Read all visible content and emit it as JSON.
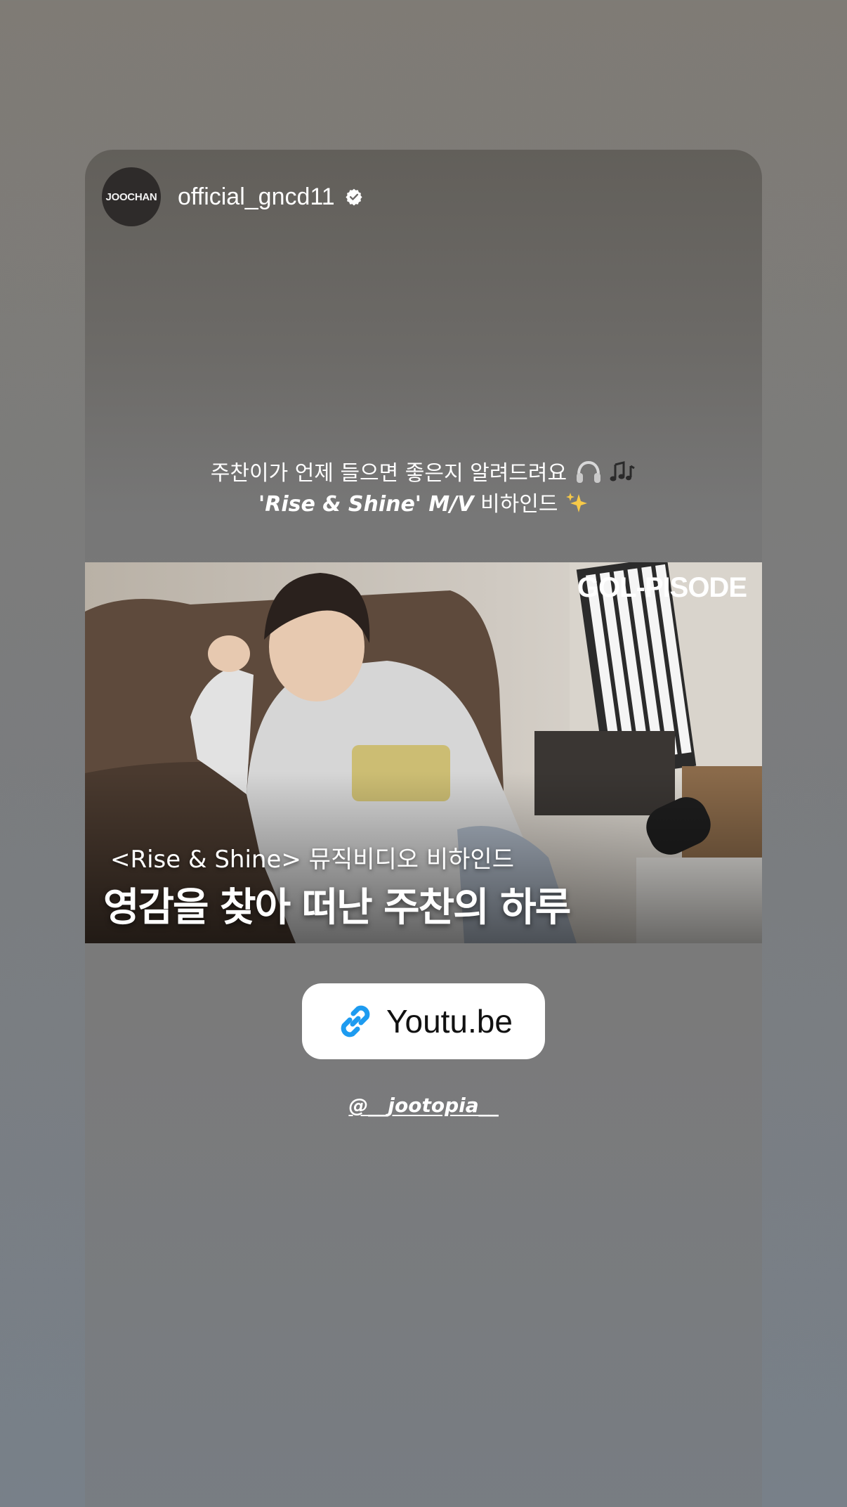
{
  "story": {
    "account": {
      "avatar_text": "JOOCHAN",
      "username": "official_gncd11",
      "verified_icon": "verified-badge-icon"
    },
    "caption": {
      "line1_text": "주찬이가 언제 들으면 좋은지 알려드려요",
      "line1_emojis": [
        "headphone-emoji",
        "music-notes-emoji"
      ],
      "line2_title": "'Rise & Shine' M/V",
      "line2_suffix": "비하인드",
      "line2_emoji": "sparkles-emoji"
    },
    "thumbnail": {
      "brand": "GOL-PISODE",
      "subtitle": "<Rise & Shine> 뮤직비디오 비하인드",
      "headline": "영감을 찾아 떠난 주찬의 하루"
    },
    "link_sticker": {
      "icon": "link-icon",
      "label": "Youtu.be",
      "accent_color": "#1d9bf0"
    },
    "mention": "@__jootopia__"
  }
}
